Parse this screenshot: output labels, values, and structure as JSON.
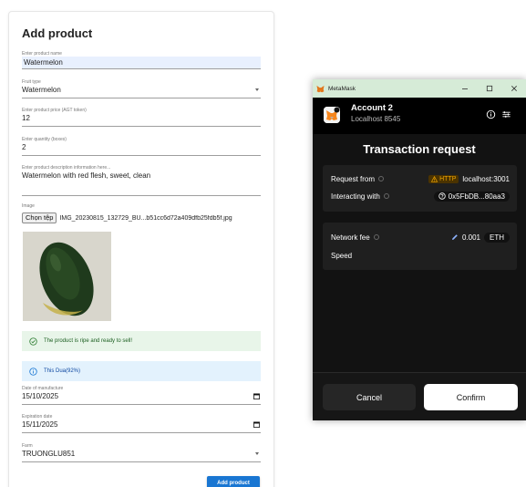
{
  "form": {
    "title": "Add product",
    "name_label": "Enter product name",
    "name_value": "Watermelon",
    "fruit_type_label": "Fruit type",
    "fruit_type_value": "Watermelon",
    "price_label": "Enter product price (AGT token)",
    "price_value": "12",
    "quantity_label": "Enter quantity (boxes)",
    "quantity_value": "2",
    "description_label": "Enter product description information here...",
    "description_value": "Watermelon with red flesh, sweet, clean",
    "image_label": "Image",
    "choose_file_label": "Chọn tệp",
    "file_name": "IMG_20230815_132729_BU...b51cc6d72a409dfb25fdb5f.jpg",
    "ripe_message": "The product is ripe and ready to sell!",
    "prediction_message": "This Dua(92%)",
    "manufacture_label": "Date of manufacture",
    "manufacture_value": "15/10/2025",
    "expiration_label": "Expiration date",
    "expiration_value": "15/11/2025",
    "farm_label": "Farm",
    "farm_value": "TRUONGLU851",
    "submit_label": "Add product"
  },
  "metamask": {
    "window_title": "MetaMask",
    "account_name": "Account 2",
    "network": "Localhost 8545",
    "heading": "Transaction request",
    "request_from_label": "Request from",
    "http_badge": "HTTP",
    "request_from_value": "localhost:3001",
    "interacting_label": "Interacting with",
    "interacting_value": "0x5FbDB...80aa3",
    "network_fee_label": "Network fee",
    "network_fee_value": "0.001",
    "currency": "ETH",
    "speed_label": "Speed",
    "cancel_label": "Cancel",
    "confirm_label": "Confirm"
  },
  "colors": {
    "primary_button": "#1976d2",
    "success_bg": "#e8f5e9",
    "info_bg": "#e3f2fd",
    "metamask_bg": "#121212",
    "metamask_titlebar": "#d6ebd7",
    "warning": "#f0a400"
  },
  "icons": [
    "check-circle-icon",
    "info-icon",
    "calendar-icon",
    "chevron-down-icon",
    "metamask-fox-icon",
    "minimize-icon",
    "maximize-icon",
    "close-icon",
    "info-circle-icon",
    "settings-sliders-icon",
    "warning-icon",
    "question-circle-icon",
    "edit-pencil-icon"
  ]
}
